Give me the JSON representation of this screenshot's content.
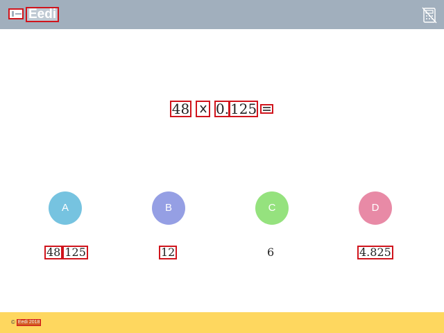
{
  "header": {
    "brand": "Eedi",
    "logo_icon": "eedi-logo-icon",
    "calculator_icon": "calculator-disabled-icon"
  },
  "question": {
    "operand1": "48",
    "operator": "×",
    "operand2_int": "0.",
    "operand2_frac": "125",
    "equals": "="
  },
  "options": [
    {
      "letter": "A",
      "color": "#76c3e0",
      "answer_part1": "48",
      "answer_part2": "125"
    },
    {
      "letter": "B",
      "color": "#959fe4",
      "answer": "12"
    },
    {
      "letter": "C",
      "color": "#95e27e",
      "answer": "6"
    },
    {
      "letter": "D",
      "color": "#e88aa6",
      "answer": "4.825"
    }
  ],
  "footer": {
    "symbol": "©",
    "text": "Eedi 2018"
  },
  "colors": {
    "header_bg": "#a1afbd",
    "footer_bg": "#fed75f",
    "highlight": "#d0141c"
  }
}
